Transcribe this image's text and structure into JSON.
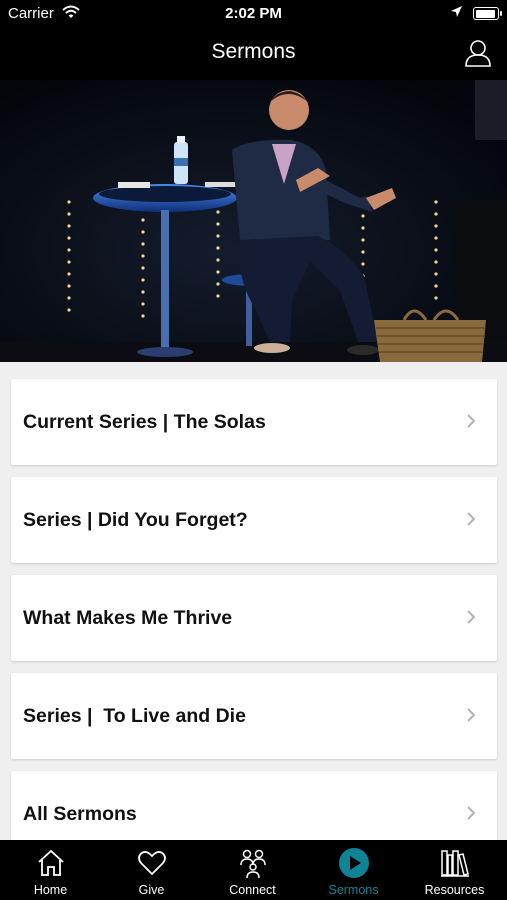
{
  "status": {
    "carrier": "Carrier",
    "time": "2:02 PM",
    "battery_level": 0.95
  },
  "header": {
    "title": "Sermons"
  },
  "hero": {
    "alt": "Pastor speaking on stage"
  },
  "sermons": [
    {
      "label": "Current Series | The Solas"
    },
    {
      "label": "Series | Did You Forget?"
    },
    {
      "label": "What Makes Me Thrive"
    },
    {
      "label": "Series |  To Live and Die"
    },
    {
      "label": "All Sermons"
    }
  ],
  "tabs": [
    {
      "label": "Home",
      "icon": "home-icon"
    },
    {
      "label": "Give",
      "icon": "heart-icon"
    },
    {
      "label": "Connect",
      "icon": "people-icon"
    },
    {
      "label": "Sermons",
      "icon": "play-circle-icon",
      "active": true
    },
    {
      "label": "Resources",
      "icon": "books-icon"
    }
  ],
  "colors": {
    "active_tab": "#0e8496",
    "bars": "#000000",
    "background": "#efeff0"
  }
}
